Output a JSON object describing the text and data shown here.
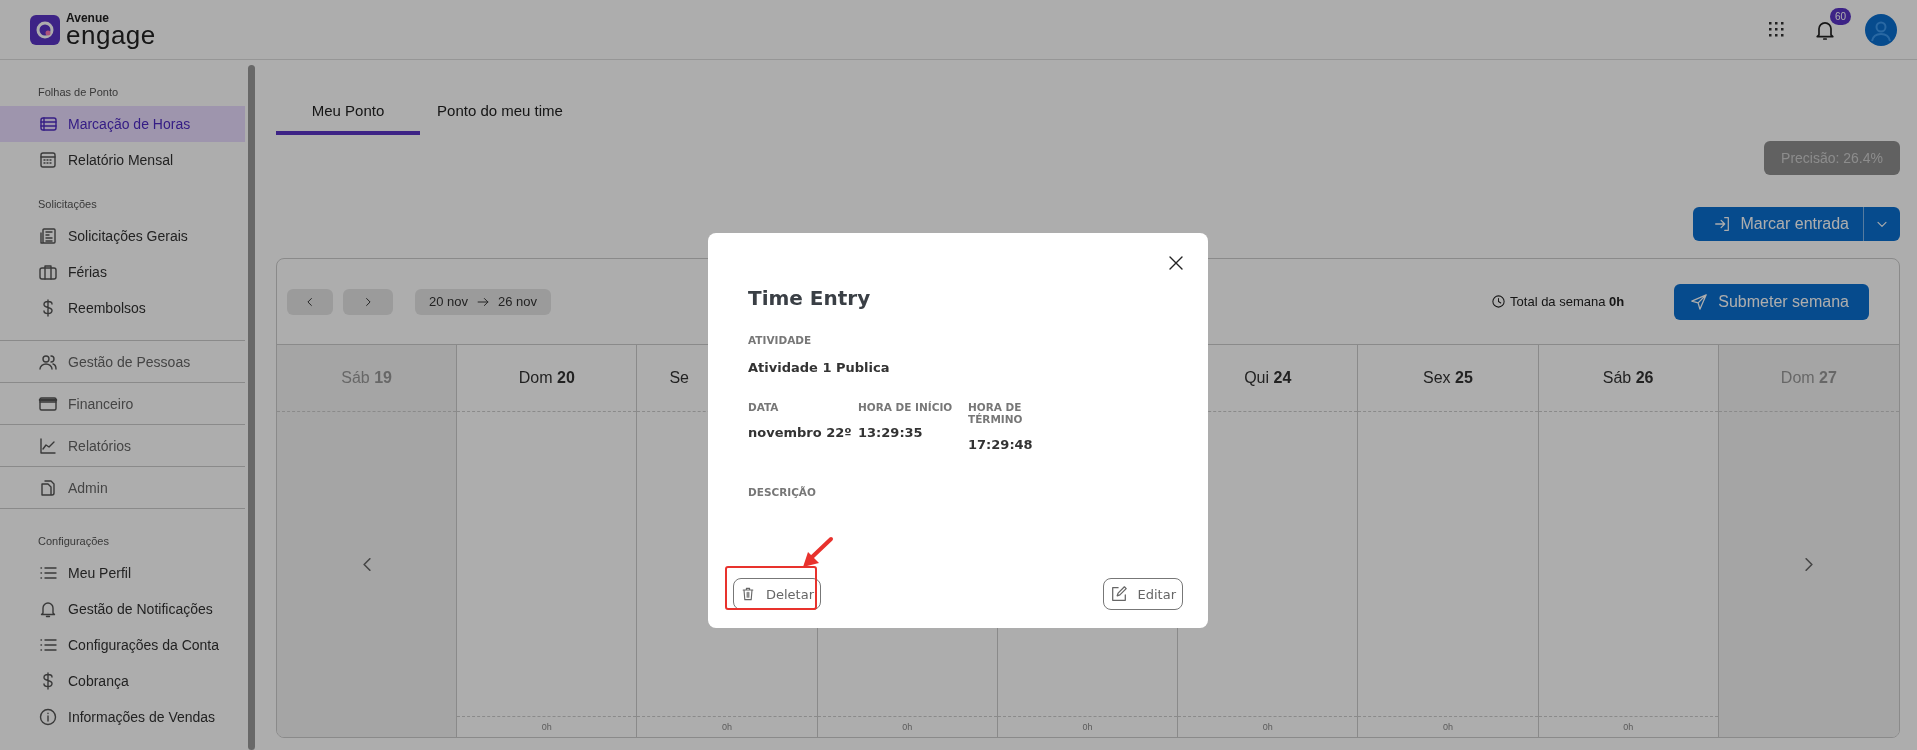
{
  "header": {
    "logo_small": "Avenue",
    "logo_large": "engage",
    "notifications": "60"
  },
  "sidebar": {
    "blocks": [
      {
        "kind": "section",
        "title": "Folhas de Ponto",
        "items": [
          {
            "label": "Marcação de Horas",
            "selected": true
          },
          {
            "label": "Relatório Mensal",
            "selected": false
          }
        ]
      },
      {
        "kind": "section",
        "title": "Solicitações",
        "items": [
          {
            "label": "Solicitações Gerais",
            "selected": false
          },
          {
            "label": "Férias",
            "selected": false
          },
          {
            "label": "Reembolsos",
            "selected": false
          }
        ]
      },
      {
        "kind": "menu",
        "items": [
          {
            "label": "Gestão de Pessoas",
            "selected": false
          },
          {
            "label": "Financeiro",
            "selected": false
          },
          {
            "label": "Relatórios",
            "selected": false
          },
          {
            "label": "Admin",
            "selected": false
          }
        ]
      },
      {
        "kind": "section",
        "title": "Configurações",
        "items": [
          {
            "label": "Meu Perfil",
            "selected": false
          },
          {
            "label": "Gestão de Notificações",
            "selected": false
          },
          {
            "label": "Configurações da Conta",
            "selected": false
          },
          {
            "label": "Cobrança",
            "selected": false
          },
          {
            "label": "Informações de Vendas",
            "selected": false
          }
        ]
      }
    ]
  },
  "tabs": [
    {
      "label": "Meu Ponto",
      "selected": true
    },
    {
      "label": "Ponto do meu time",
      "selected": false
    }
  ],
  "precision": "Precisão: 26.4%",
  "clock_in": "Marcar entrada",
  "calendar": {
    "range_start": "20 nov",
    "range_end": "26 nov",
    "total_label": "Total da semana",
    "total_value": "0h",
    "submit": "Submeter semana",
    "days": [
      {
        "name": "Sáb",
        "number": "19",
        "muted": true
      },
      {
        "name": "Dom",
        "number": "20",
        "muted": false,
        "total": "0h"
      },
      {
        "name": "Se",
        "muted": false,
        "total": "0h"
      },
      {
        "total": "0h"
      },
      {
        "total": "0h"
      },
      {
        "name": "Qui",
        "number": "24",
        "muted": false,
        "total": "0h"
      },
      {
        "name": "Sex",
        "number": "25",
        "muted": false,
        "total": "0h"
      },
      {
        "name": "Sáb",
        "number": "26",
        "muted": false,
        "total": "0h"
      },
      {
        "name": "Dom",
        "number": "27",
        "muted": true
      }
    ]
  },
  "modal": {
    "title": "Time Entry",
    "activity_label": "ATIVIDADE",
    "activity": "Atividade 1 Publica",
    "fields": [
      {
        "label": "DATA",
        "value": "novembro 22º"
      },
      {
        "label": "HORA DE INÍCIO",
        "value": "13:29:35"
      },
      {
        "label": "HORA DE TÉRMINO",
        "value": "17:29:48"
      }
    ],
    "description_label": "DESCRIÇÃO",
    "delete": "Deletar",
    "edit": "Editar"
  }
}
